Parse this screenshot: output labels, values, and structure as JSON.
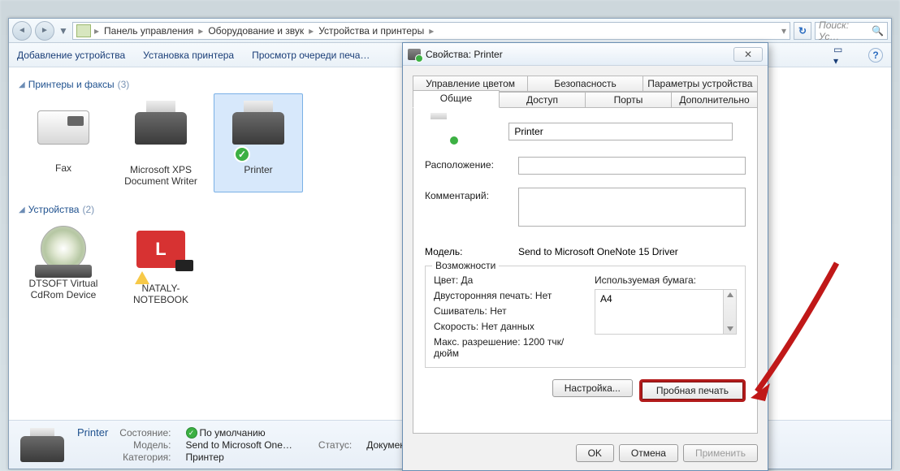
{
  "breadcrumb": {
    "seg1": "Панель управления",
    "seg2": "Оборудование и звук",
    "seg3": "Устройства и принтеры"
  },
  "search": {
    "placeholder": "Поиск: Ус…"
  },
  "cmdbar": {
    "add_device": "Добавление устройства",
    "add_printer": "Установка принтера",
    "view_queue": "Просмотр очереди печа…"
  },
  "groups": {
    "printers": {
      "title": "Принтеры и факсы",
      "count": "(3)"
    },
    "devices": {
      "title": "Устройства",
      "count": "(2)"
    }
  },
  "items": {
    "fax": "Fax",
    "xps": "Microsoft XPS Document Writer",
    "printer": "Printer",
    "dtsoft": "DTSOFT Virtual CdRom Device",
    "nataly": "NATALY-NOTEBOOK"
  },
  "details": {
    "title": "Printer",
    "state_k": "Состояние:",
    "state_v": "По умолчанию",
    "model_k": "Модель:",
    "model_v": "Send to Microsoft One…",
    "cat_k": "Категория:",
    "cat_v": "Принтер",
    "status_k": "Статус:",
    "status_v": "Документов…"
  },
  "dialog": {
    "title": "Свойства: Printer",
    "tabs_top": {
      "color": "Управление цветом",
      "security": "Безопасность",
      "device": "Параметры устройства"
    },
    "tabs_bot": {
      "general": "Общие",
      "sharing": "Доступ",
      "ports": "Порты",
      "advanced": "Дополнительно"
    },
    "name_value": "Printer",
    "location_label": "Расположение:",
    "comment_label": "Комментарий:",
    "model_label": "Модель:",
    "model_value": "Send to Microsoft OneNote 15 Driver",
    "caps_legend": "Возможности",
    "caps": {
      "color": "Цвет: Да",
      "duplex": "Двусторонняя печать: Нет",
      "stapler": "Сшиватель: Нет",
      "speed": "Скорость: Нет данных",
      "maxres": "Макс. разрешение: 1200 тчк/дюйм"
    },
    "paper_label": "Используемая бумага:",
    "paper_item": "A4",
    "btn_settings": "Настройка...",
    "btn_test": "Пробная печать",
    "btn_ok": "OK",
    "btn_cancel": "Отмена",
    "btn_apply": "Применить"
  }
}
